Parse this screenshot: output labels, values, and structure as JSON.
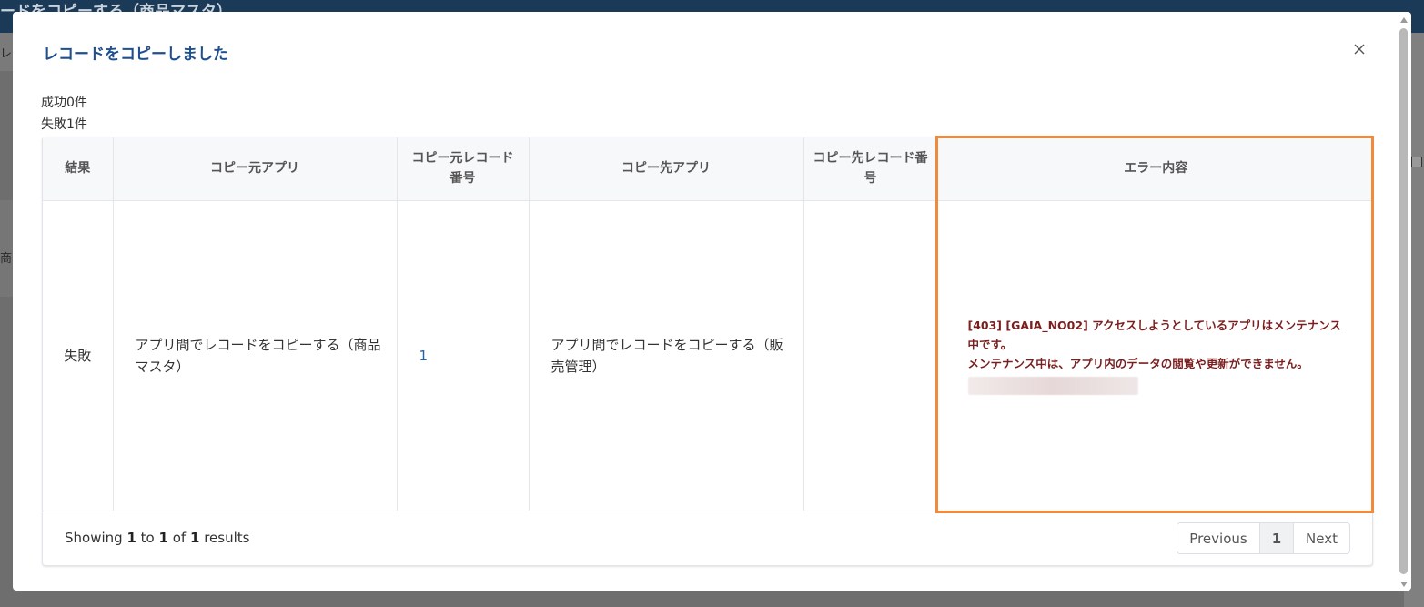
{
  "background": {
    "title": "ードをコピーする（商品マスタ）",
    "fragment_left_1": "レ",
    "fragment_left_2": "商品"
  },
  "modal": {
    "title": "レコードをコピーしました",
    "close_icon": "close-icon",
    "summary": {
      "success": "成功0件",
      "failure": "失敗1件"
    },
    "table": {
      "headers": {
        "result": "結果",
        "source_app": "コピー元アプリ",
        "source_record": "コピー元レコード番号",
        "dest_app": "コピー先アプリ",
        "dest_record": "コピー先レコード番号",
        "error": "エラー内容"
      },
      "rows": [
        {
          "result": "失敗",
          "source_app": "アプリ間でレコードをコピーする（商品マスタ）",
          "source_record": "1",
          "dest_app": "アプリ間でレコードをコピーする（販売管理）",
          "dest_record": "",
          "error_line1": "[403] [GAIA_NO02] アクセスしようとしているアプリはメンテナンス中です。",
          "error_line2": "メンテナンス中は、アプリ内のデータの閲覧や更新ができません。"
        }
      ]
    },
    "footer": {
      "showing_prefix": "Showing",
      "from": "1",
      "to_word": "to",
      "to": "1",
      "of_word": "of",
      "total": "1",
      "results_word": "results",
      "pagination": {
        "previous": "Previous",
        "current": "1",
        "next": "Next"
      }
    }
  },
  "colors": {
    "title_blue": "#1e4f8e",
    "error_text": "#7a1f1f",
    "highlight_orange": "#f08a3c",
    "link_blue": "#2563a8"
  }
}
